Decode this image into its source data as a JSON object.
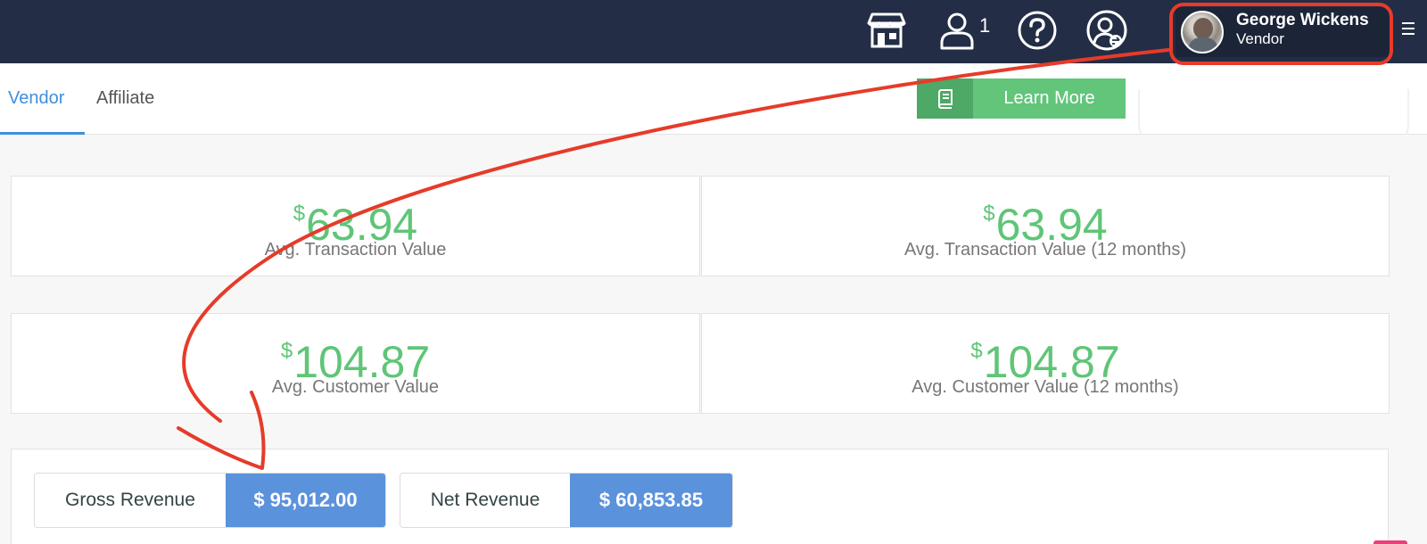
{
  "header": {
    "icons": [
      "storefront-icon",
      "user-icon",
      "help-icon",
      "account-switch-icon"
    ],
    "user_count": "1",
    "profile": {
      "name": "George Wickens",
      "role": "Vendor"
    }
  },
  "tabs": [
    {
      "label": "Vendor",
      "active": true
    },
    {
      "label": "Affiliate",
      "active": false
    }
  ],
  "learn_more": {
    "label": "Learn More",
    "icon": "book-icon"
  },
  "stats": [
    {
      "currency": "$",
      "value": "63.94",
      "label": "Avg. Transaction Value"
    },
    {
      "currency": "$",
      "value": "63.94",
      "label": "Avg. Transaction Value (12 months)"
    },
    {
      "currency": "$",
      "value": "104.87",
      "label": "Avg. Customer Value"
    },
    {
      "currency": "$",
      "value": "104.87",
      "label": "Avg. Customer Value (12 months)"
    }
  ],
  "revenue": [
    {
      "label": "Gross Revenue",
      "value": "$ 95,012.00"
    },
    {
      "label": "Net Revenue",
      "value": "$ 60,853.85"
    }
  ],
  "colors": {
    "header_bg": "#232d45",
    "accent_blue": "#3f8fe0",
    "stat_green": "#5fc577",
    "learn_green": "#62c57a",
    "revenue_blue": "#5b92dc",
    "annotation_red": "#e63b2a"
  }
}
